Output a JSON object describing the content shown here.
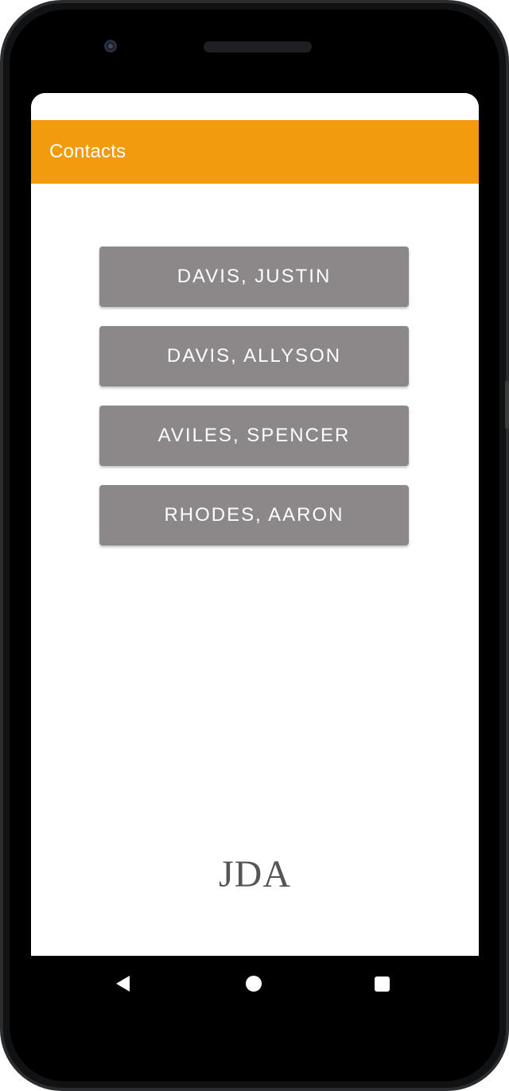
{
  "app_bar": {
    "title": "Contacts",
    "color": "#f29b0c"
  },
  "contacts": [
    {
      "label": "DAVIS, JUSTIN"
    },
    {
      "label": "DAVIS, ALLYSON"
    },
    {
      "label": "AVILES, SPENCER"
    },
    {
      "label": "RHODES, AARON"
    }
  ],
  "button_color": "#8c8889",
  "logo": {
    "text": "JDA"
  },
  "nav_bar": {
    "back_icon": "back-triangle-icon",
    "home_icon": "home-circle-icon",
    "recents_icon": "recents-square-icon"
  }
}
